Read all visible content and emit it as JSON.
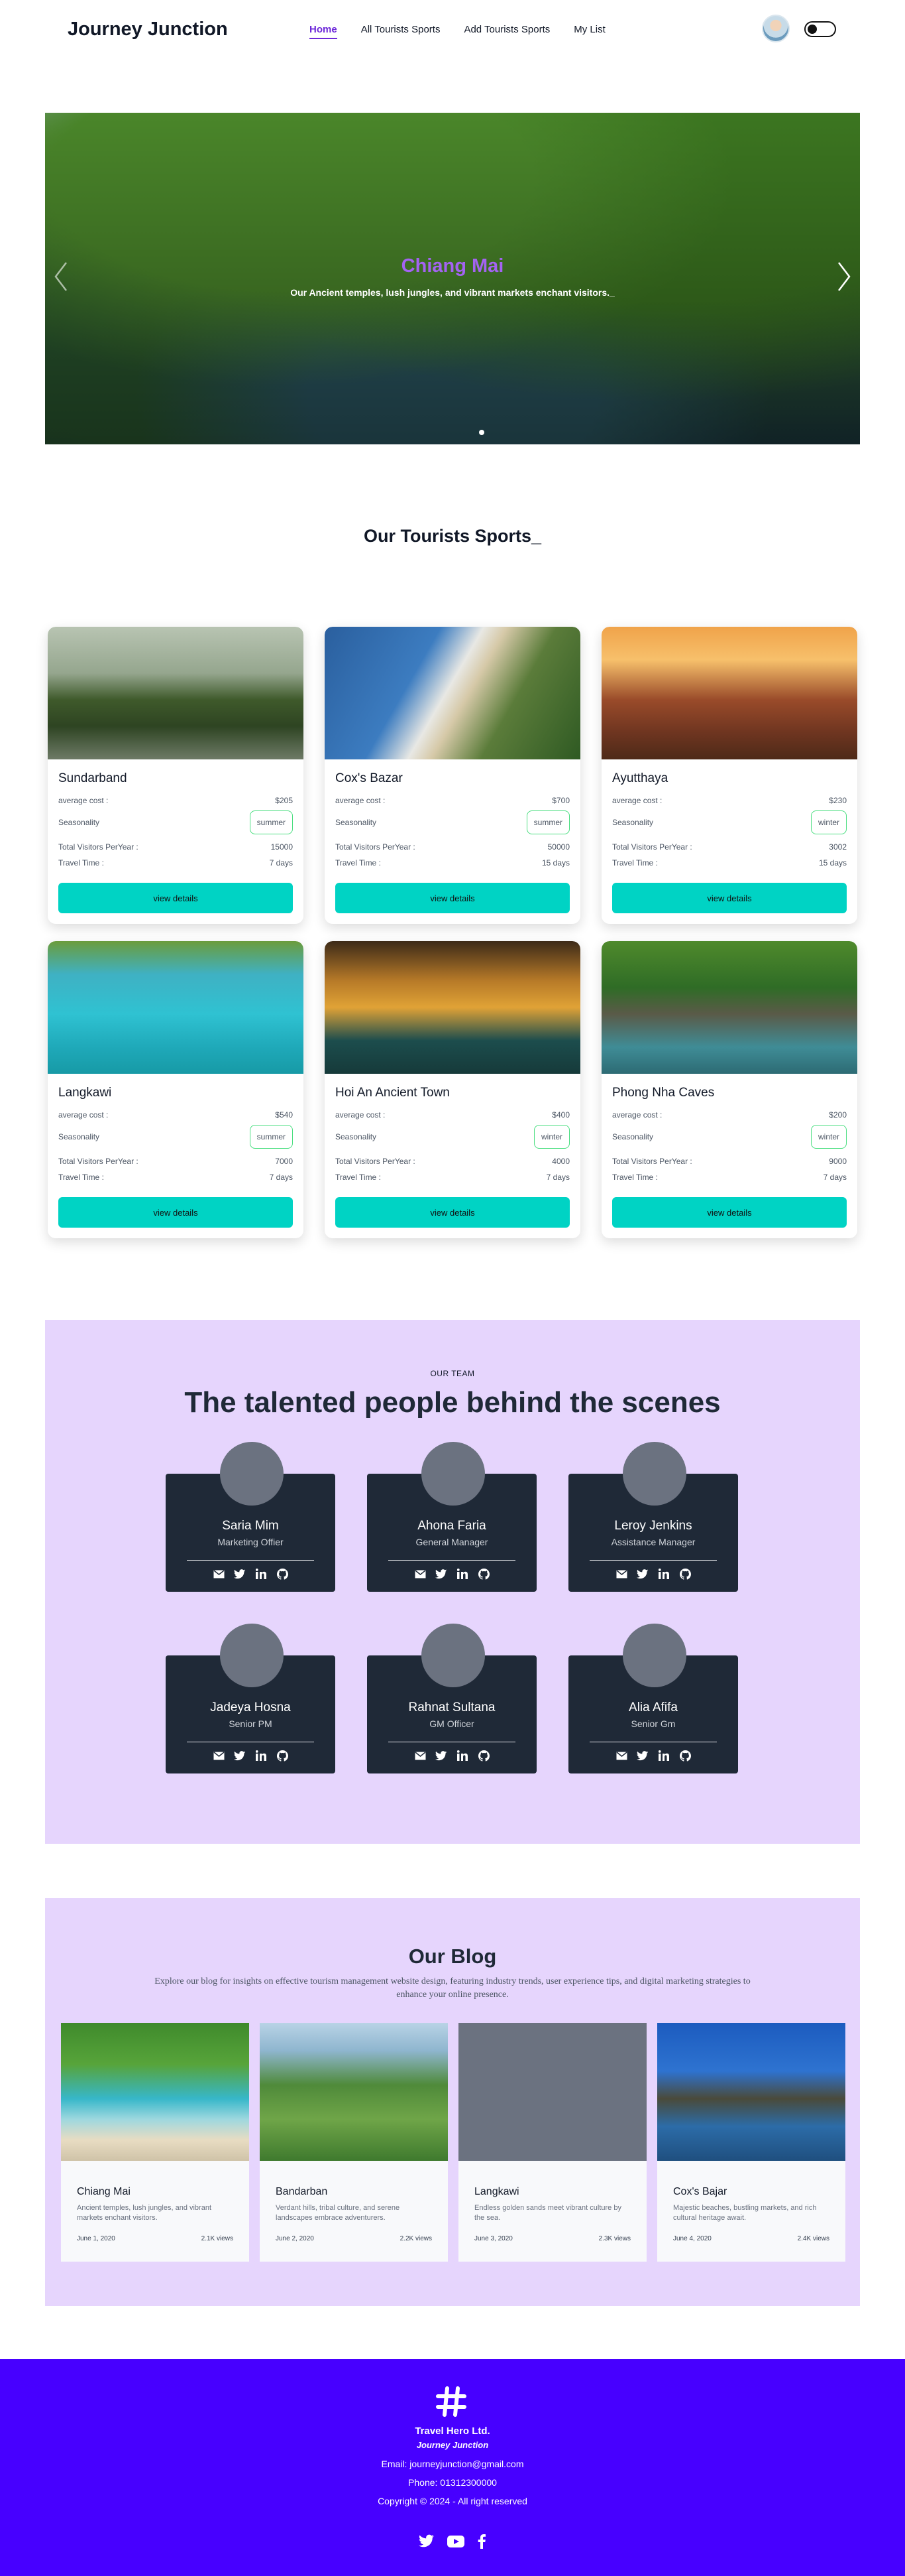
{
  "nav": {
    "brand": "Journey Junction",
    "links": [
      "Home",
      "All Tourists Sports",
      "Add Tourists Sports",
      "My List"
    ]
  },
  "hero": {
    "title": "Chiang Mai",
    "subtitle": "Our Ancient temples, lush jungles, and vibrant markets enchant visitors._"
  },
  "sports": {
    "title": "Our Tourists Sports_",
    "labels": {
      "cost": "average cost :",
      "season": "Seasonality",
      "visitors": "Total Visitors PerYear :",
      "time": "Travel Time :",
      "button": "view details"
    },
    "items": [
      {
        "name": "Sundarband",
        "cost": "$205",
        "season": "summer",
        "visitors": "15000",
        "time": "7 days"
      },
      {
        "name": "Cox's Bazar",
        "cost": "$700",
        "season": "summer",
        "visitors": "50000",
        "time": "15 days"
      },
      {
        "name": "Ayutthaya",
        "cost": "$230",
        "season": "winter",
        "visitors": "3002",
        "time": "15 days"
      },
      {
        "name": "Langkawi",
        "cost": "$540",
        "season": "summer",
        "visitors": "7000",
        "time": "7 days"
      },
      {
        "name": "Hoi An Ancient Town",
        "cost": "$400",
        "season": "winter",
        "visitors": "4000",
        "time": "7 days"
      },
      {
        "name": "Phong Nha Caves",
        "cost": "$200",
        "season": "winter",
        "visitors": "9000",
        "time": "7 days"
      }
    ]
  },
  "team": {
    "kicker": "OUR TEAM",
    "title": "The talented people behind the scenes",
    "members": [
      {
        "name": "Saria Mim",
        "role": "Marketing Offier"
      },
      {
        "name": "Ahona Faria",
        "role": "General Manager"
      },
      {
        "name": "Leroy Jenkins",
        "role": "Assistance Manager"
      },
      {
        "name": "Jadeya Hosna",
        "role": "Senior PM"
      },
      {
        "name": "Rahnat Sultana",
        "role": "GM Officer"
      },
      {
        "name": "Alia Afifa",
        "role": "Senior Gm"
      }
    ]
  },
  "blog": {
    "title": "Our Blog",
    "description": "Explore our blog for insights on effective tourism management website design, featuring industry trends, user experience tips, and digital marketing strategies to enhance your online presence.",
    "posts": [
      {
        "title": "Chiang Mai",
        "desc": "Ancient temples, lush jungles, and vibrant markets enchant visitors.",
        "date": "June 1, 2020",
        "views": "2.1K views"
      },
      {
        "title": "Bandarban",
        "desc": "Verdant hills, tribal culture, and serene landscapes embrace adventurers.",
        "date": "June 2, 2020",
        "views": "2.2K views"
      },
      {
        "title": "Langkawi",
        "desc": "Endless golden sands meet vibrant culture by the sea.",
        "date": "June 3, 2020",
        "views": "2.3K views"
      },
      {
        "title": "Cox's Bajar",
        "desc": "Majestic beaches, bustling markets, and rich cultural heritage await.",
        "date": "June 4, 2020",
        "views": "2.4K views"
      }
    ]
  },
  "footer": {
    "company": "Travel Hero Ltd.",
    "brand": "Journey Junction",
    "email": "Email: journeyjunction@gmail.com",
    "phone": "Phone: 01312300000",
    "copyright": "Copyright © 2024 - All right reserved"
  },
  "colors": {
    "accent": "#6d28d9",
    "button": "#00d3c4",
    "section_bg": "#e6d5fd",
    "footer_bg": "#4700ff",
    "team_card": "#1f2937"
  }
}
